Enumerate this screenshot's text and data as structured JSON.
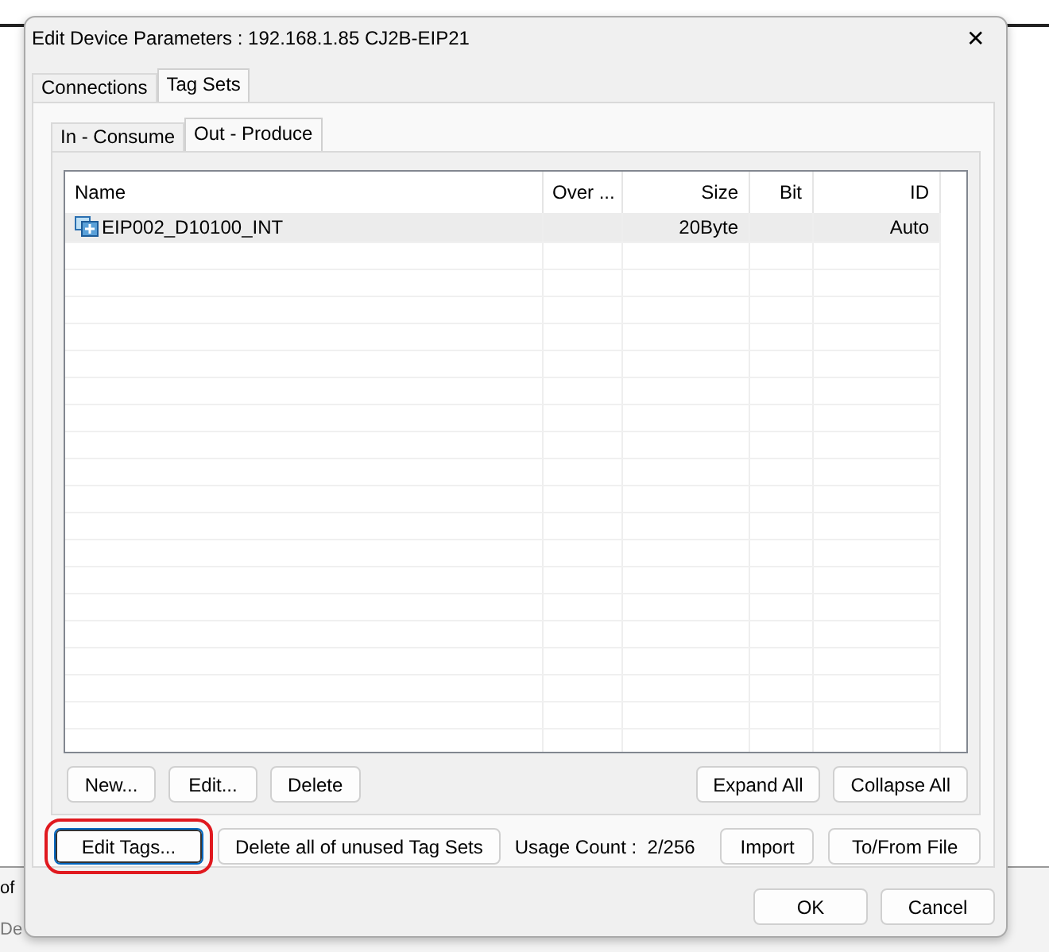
{
  "background": {
    "fragments": [
      "of",
      "De"
    ]
  },
  "window": {
    "title": "Edit Device Parameters : 192.168.1.85 CJ2B-EIP21",
    "close": "✕"
  },
  "tabs": [
    {
      "label": "Connections",
      "selected": false
    },
    {
      "label": "Tag Sets",
      "selected": true
    }
  ],
  "subtabs": [
    {
      "label": "In - Consume",
      "selected": false
    },
    {
      "label": "Out - Produce",
      "selected": true
    }
  ],
  "table": {
    "columns": [
      "Name",
      "Over ...",
      "Size",
      "Bit",
      "ID"
    ],
    "rows": [
      {
        "selected": true,
        "cells": [
          "EIP002_D10100_INT",
          "",
          "20Byte",
          "",
          "Auto"
        ]
      }
    ]
  },
  "list_buttons_left": [
    "New...",
    "Edit...",
    "Delete"
  ],
  "list_buttons_right": [
    "Expand All",
    "Collapse All"
  ],
  "bottom_bar": [
    {
      "kind": "button",
      "label": "Edit Tags...",
      "highlighted": true
    },
    {
      "kind": "button",
      "label": "Delete all of unused Tag Sets",
      "highlighted": false
    },
    {
      "kind": "text",
      "label": "Usage Count :  2/256"
    },
    {
      "kind": "button",
      "label": "Import",
      "highlighted": false
    },
    {
      "kind": "button",
      "label": "To/From File",
      "highlighted": false
    }
  ],
  "dialog_buttons": [
    "OK",
    "Cancel"
  ]
}
